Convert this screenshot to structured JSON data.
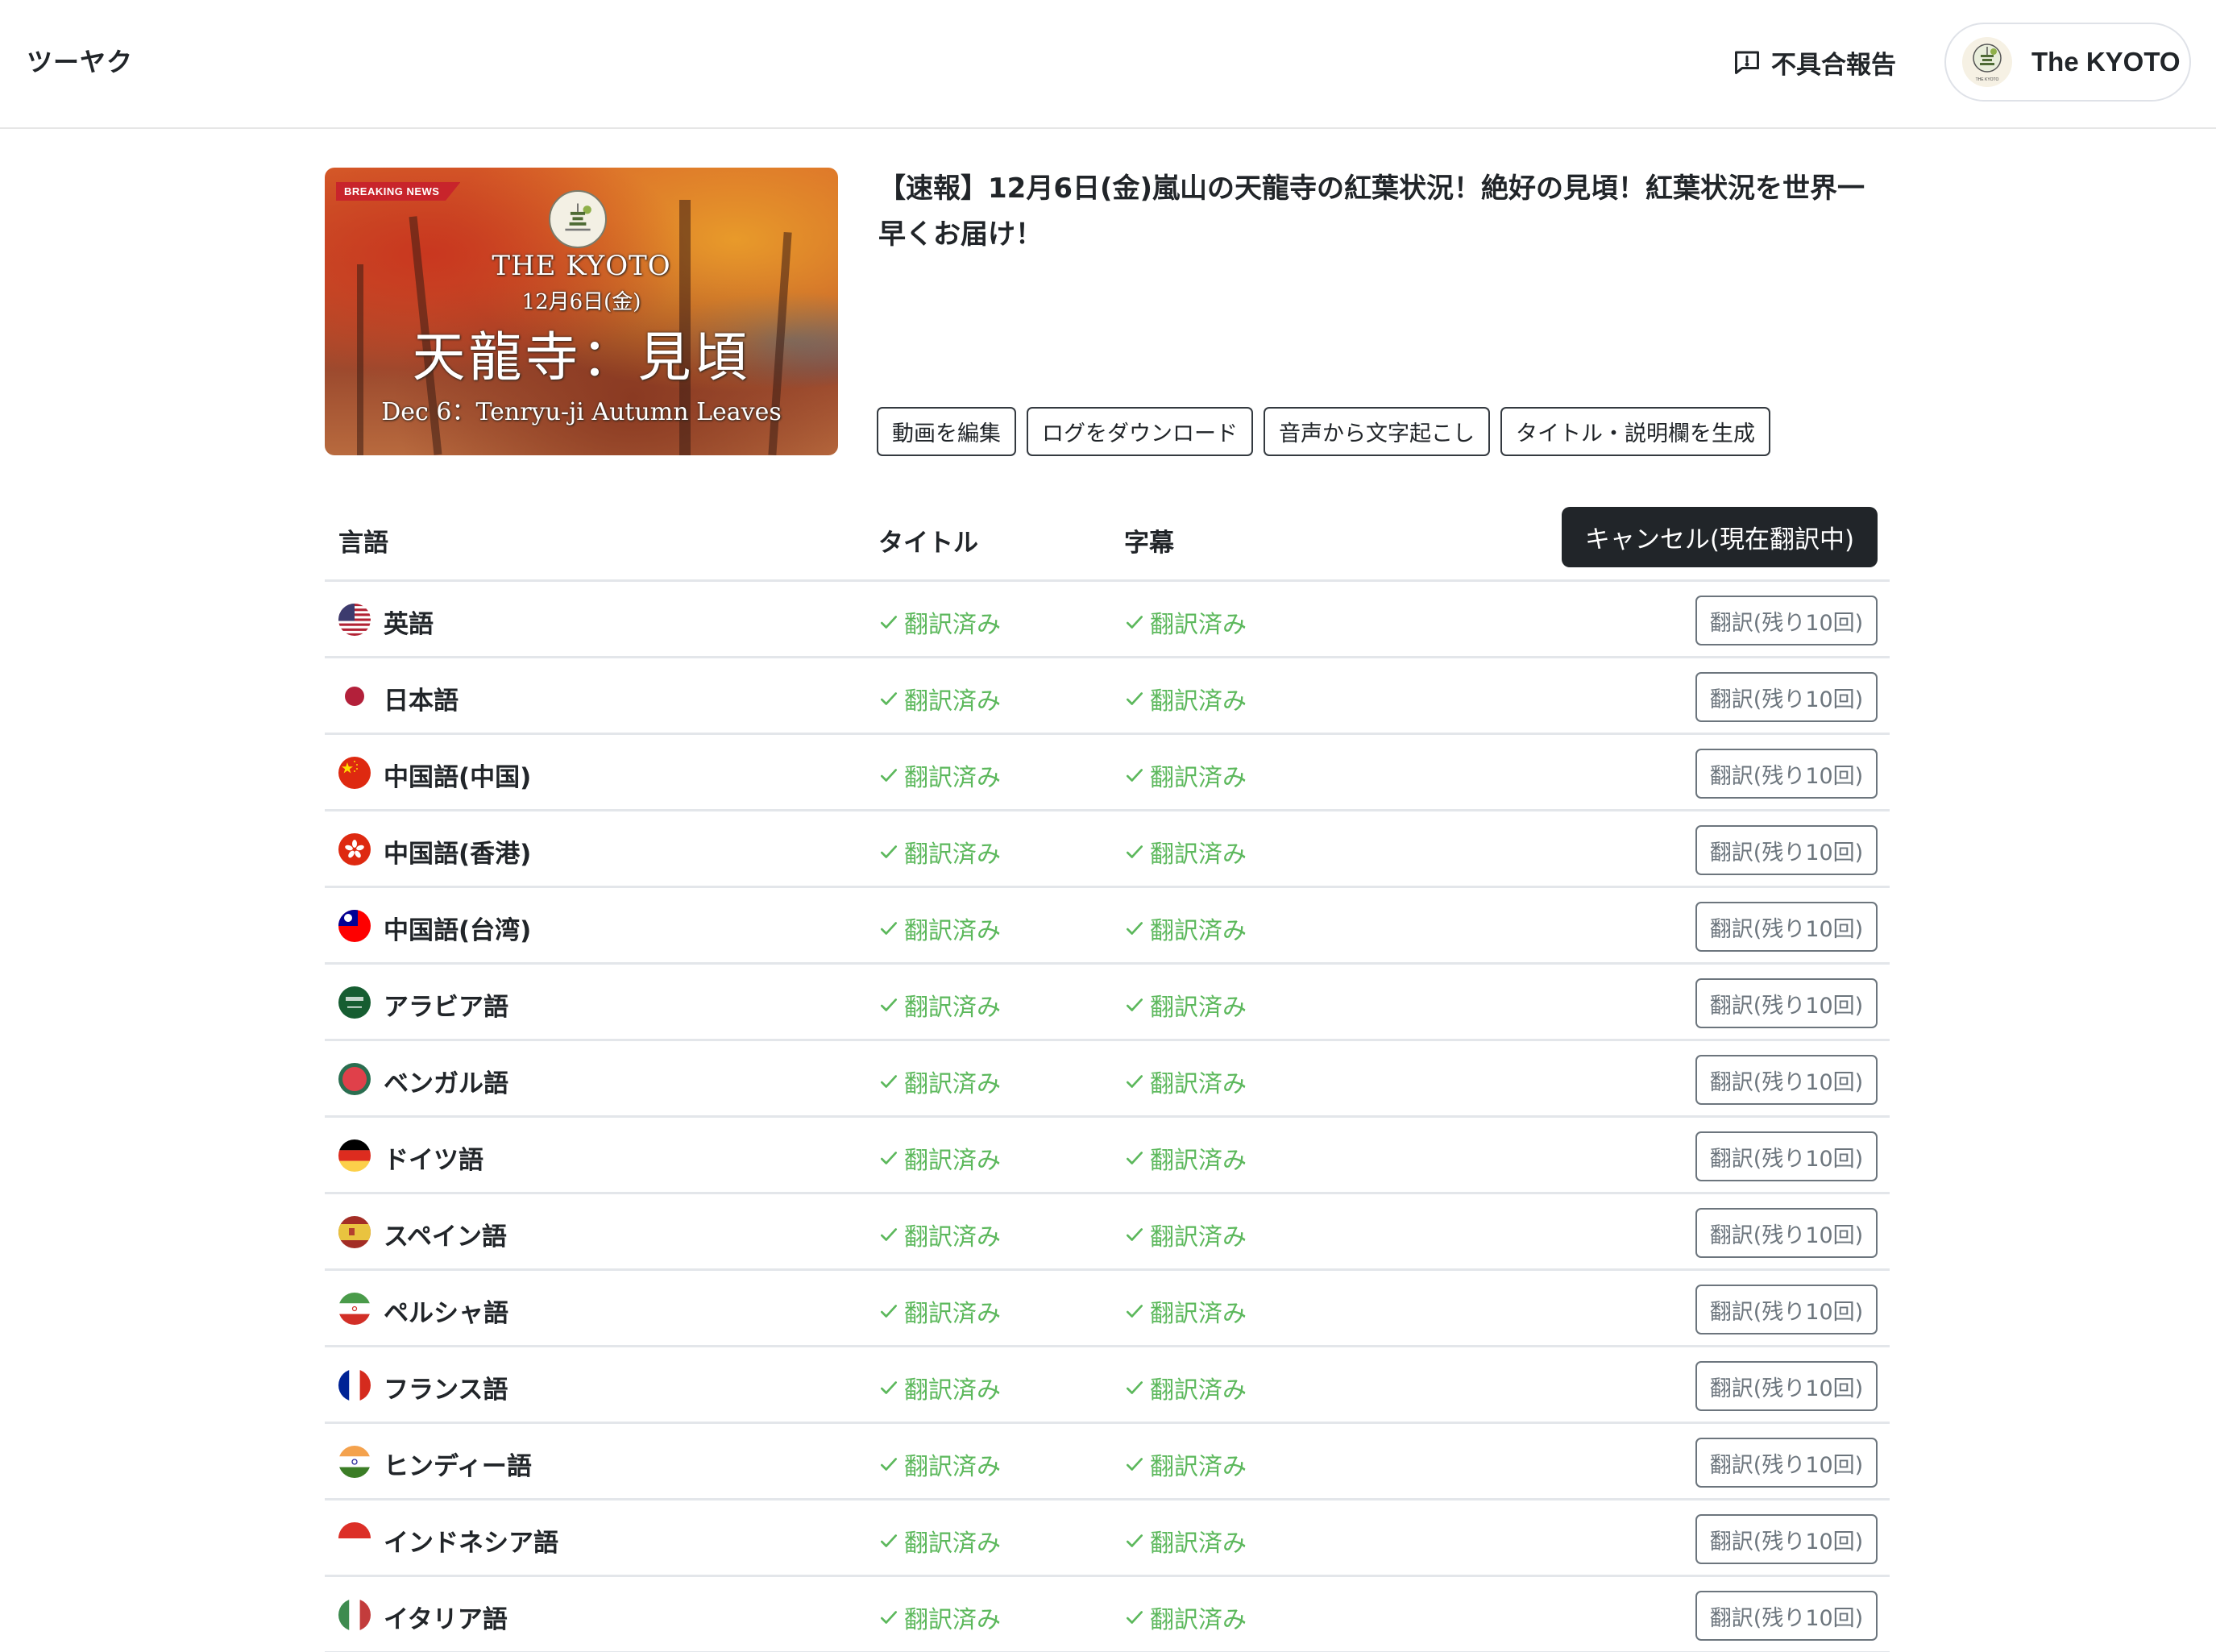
{
  "header": {
    "brand": "ツーヤク",
    "report_label": "不具合報告",
    "account_name": "The KYOTO",
    "avatar_caption": "THE KYOTO"
  },
  "video": {
    "thumbnail": {
      "badge": "BREAKING NEWS",
      "channel": "THE KYOTO",
      "date": "12月6日(金)",
      "headline": "天龍寺：見頃",
      "subline": "Dec 6：Tenryu-ji Autumn Leaves"
    },
    "title": "【速報】12月6日(金)嵐山の天龍寺の紅葉状況！絶好の見頃！紅葉状況を世界一早くお届け！",
    "actions": [
      "動画を編集",
      "ログをダウンロード",
      "音声から文字起こし",
      "タイトル・説明欄を生成"
    ]
  },
  "table": {
    "columns": {
      "language": "言語",
      "title": "タイトル",
      "subtitles": "字幕"
    },
    "cancel_label": "キャンセル(現在翻訳中)",
    "status_color": "#5cb85c",
    "rows": [
      {
        "flag": "us-flag-icon",
        "language": "英語",
        "title_status": "翻訳済み",
        "subtitle_status": "翻訳済み",
        "button": "翻訳(残り10回)"
      },
      {
        "flag": "jp-flag-icon",
        "language": "日本語",
        "title_status": "翻訳済み",
        "subtitle_status": "翻訳済み",
        "button": "翻訳(残り10回)"
      },
      {
        "flag": "cn-flag-icon",
        "language": "中国語(中国)",
        "title_status": "翻訳済み",
        "subtitle_status": "翻訳済み",
        "button": "翻訳(残り10回)"
      },
      {
        "flag": "hk-flag-icon",
        "language": "中国語(香港)",
        "title_status": "翻訳済み",
        "subtitle_status": "翻訳済み",
        "button": "翻訳(残り10回)"
      },
      {
        "flag": "tw-flag-icon",
        "language": "中国語(台湾)",
        "title_status": "翻訳済み",
        "subtitle_status": "翻訳済み",
        "button": "翻訳(残り10回)"
      },
      {
        "flag": "sa-flag-icon",
        "language": "アラビア語",
        "title_status": "翻訳済み",
        "subtitle_status": "翻訳済み",
        "button": "翻訳(残り10回)"
      },
      {
        "flag": "bd-flag-icon",
        "language": "ベンガル語",
        "title_status": "翻訳済み",
        "subtitle_status": "翻訳済み",
        "button": "翻訳(残り10回)"
      },
      {
        "flag": "de-flag-icon",
        "language": "ドイツ語",
        "title_status": "翻訳済み",
        "subtitle_status": "翻訳済み",
        "button": "翻訳(残り10回)"
      },
      {
        "flag": "es-flag-icon",
        "language": "スペイン語",
        "title_status": "翻訳済み",
        "subtitle_status": "翻訳済み",
        "button": "翻訳(残り10回)"
      },
      {
        "flag": "ir-flag-icon",
        "language": "ペルシャ語",
        "title_status": "翻訳済み",
        "subtitle_status": "翻訳済み",
        "button": "翻訳(残り10回)"
      },
      {
        "flag": "fr-flag-icon",
        "language": "フランス語",
        "title_status": "翻訳済み",
        "subtitle_status": "翻訳済み",
        "button": "翻訳(残り10回)"
      },
      {
        "flag": "in-flag-icon",
        "language": "ヒンディー語",
        "title_status": "翻訳済み",
        "subtitle_status": "翻訳済み",
        "button": "翻訳(残り10回)"
      },
      {
        "flag": "id-flag-icon",
        "language": "インドネシア語",
        "title_status": "翻訳済み",
        "subtitle_status": "翻訳済み",
        "button": "翻訳(残り10回)"
      },
      {
        "flag": "it-flag-icon",
        "language": "イタリア語",
        "title_status": "翻訳済み",
        "subtitle_status": "翻訳済み",
        "button": "翻訳(残り10回)"
      }
    ]
  }
}
